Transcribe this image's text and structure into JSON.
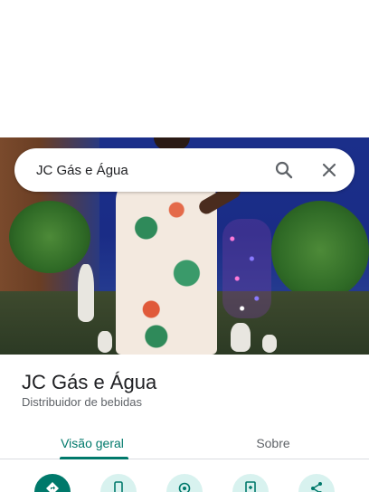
{
  "search": {
    "query": "JC Gás e Água"
  },
  "place": {
    "name": "JC Gás e Água",
    "category": "Distribuidor de bebidas"
  },
  "tabs": [
    {
      "label": "Visão geral",
      "active": true
    },
    {
      "label": "Sobre",
      "active": false
    }
  ],
  "actions": [
    {
      "icon": "directions-icon"
    },
    {
      "icon": "phone-icon"
    },
    {
      "icon": "location-icon"
    },
    {
      "icon": "save-icon"
    },
    {
      "icon": "share-icon"
    }
  ],
  "colors": {
    "accent": "#00796b",
    "accent_light": "#d8f2ef",
    "text": "#202124",
    "subtext": "#5f6368"
  }
}
